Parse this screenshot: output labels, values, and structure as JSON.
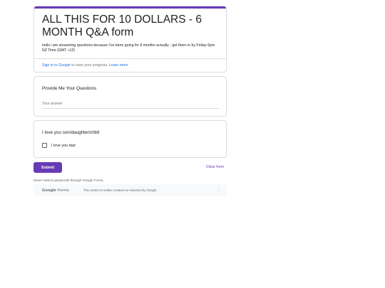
{
  "form": {
    "title": "ALL THIS FOR 10 DOLLARS - 6 MONTH Q&A form",
    "description": "hello i am answering questions because I've been going for 8 months actually  - get them in by Friday 6pm NZ Time (GMT +12)",
    "signin_link": "Sign in to Google",
    "signin_text": " to save your progress. ",
    "learn_more": "Learn more",
    "accent_color": "#673ab7"
  },
  "questions": [
    {
      "title": "Provide Me Your Questions",
      "type": "short-answer",
      "placeholder": "Your answer"
    },
    {
      "title": "I love you son/daughter/child",
      "type": "checkbox",
      "option": "I love you dad",
      "checked": false
    }
  ],
  "actions": {
    "submit_label": "Submit",
    "clear_label": "Clear form"
  },
  "footer": {
    "never_submit": "Never submit passwords through Google Forms.",
    "logo_google": "Google",
    "logo_forms": " Forms",
    "disclaimer": "This content is neither created nor endorsed by Google.",
    "menu_icon": "more-vert-icon"
  }
}
